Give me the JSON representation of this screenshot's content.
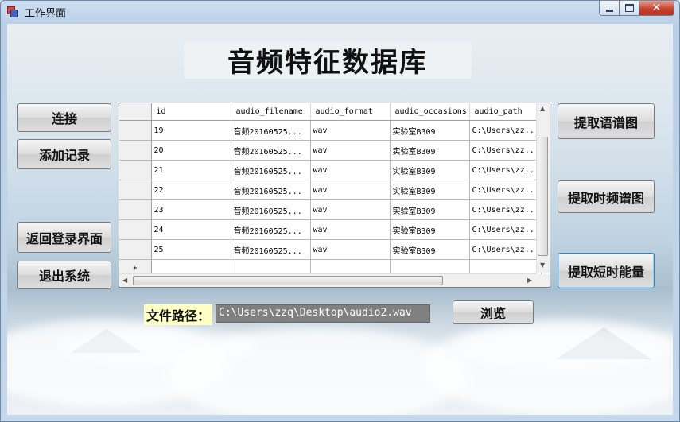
{
  "window": {
    "title": "工作界面",
    "close_glyph": "✕"
  },
  "header": {
    "banner": "音频特征数据库"
  },
  "left_buttons": {
    "connect": "连接",
    "add_record": "添加记录",
    "back_to_login": "返回登录界面",
    "exit": "退出系统"
  },
  "right_buttons": {
    "spectrogram": "提取语谱图",
    "time_freq": "提取时频谱图",
    "short_energy": "提取短时能量"
  },
  "grid": {
    "columns": [
      "id",
      "audio_filename",
      "audio_format",
      "audio_occasions",
      "audio_path"
    ],
    "rows": [
      [
        "19",
        "音频20160525...",
        "wav",
        "实验室B309",
        "C:\\Users\\zz..."
      ],
      [
        "20",
        "音频20160525...",
        "wav",
        "实验室B309",
        "C:\\Users\\zz..."
      ],
      [
        "21",
        "音频20160525...",
        "wav",
        "实验室B309",
        "C:\\Users\\zz..."
      ],
      [
        "22",
        "音频20160525...",
        "wav",
        "实验室B309",
        "C:\\Users\\zz..."
      ],
      [
        "23",
        "音频20160525...",
        "wav",
        "实验室B309",
        "C:\\Users\\zz..."
      ],
      [
        "24",
        "音频20160525...",
        "wav",
        "实验室B309",
        "C:\\Users\\zz..."
      ],
      [
        "25",
        "音频20160525...",
        "wav",
        "实验室B309",
        "C:\\Users\\zz..."
      ]
    ],
    "new_row_marker": "*"
  },
  "path": {
    "label": "文件路径：",
    "value": "C:\\Users\\zzq\\Desktop\\audio2.wav",
    "browse": "浏览"
  }
}
